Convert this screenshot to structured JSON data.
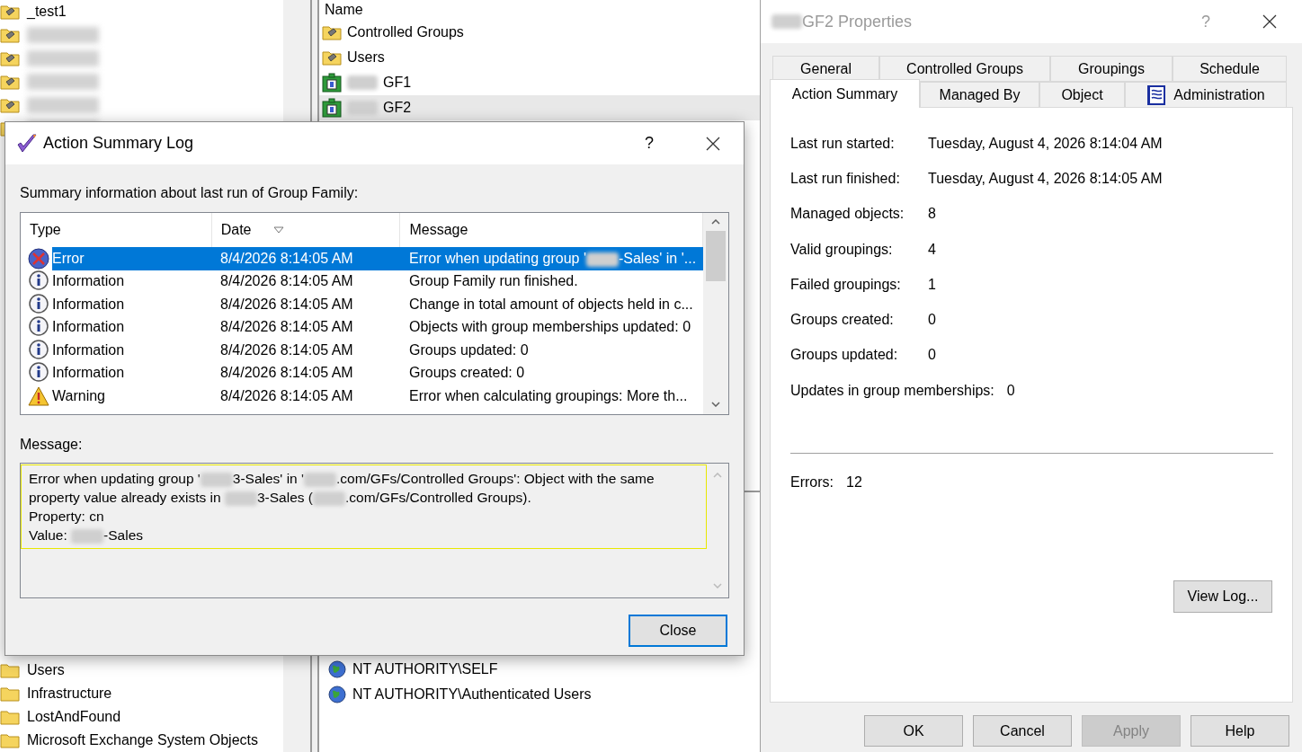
{
  "explorer": {
    "tree_top": [
      {
        "label": "_test1",
        "kind": "special"
      },
      {
        "kind": "special",
        "redacted": true
      },
      {
        "kind": "special",
        "redacted": true
      },
      {
        "kind": "special",
        "redacted": true
      },
      {
        "kind": "special",
        "redacted": true
      },
      {
        "kind": "plain",
        "redacted": true
      }
    ],
    "tree_bottom": [
      {
        "label": "Users",
        "kind": "plain"
      },
      {
        "label": "Infrastructure",
        "kind": "plain"
      },
      {
        "label": "LostAndFound",
        "kind": "plain"
      },
      {
        "label": "Microsoft Exchange System Objects",
        "kind": "plain"
      }
    ],
    "list_header": "Name",
    "list_items": [
      {
        "label": "Controlled Groups",
        "kind": "container",
        "selected": false,
        "redacted_prefix": false
      },
      {
        "label": "Users",
        "kind": "container",
        "selected": false,
        "redacted_prefix": false
      },
      {
        "label": "GF1",
        "kind": "family",
        "selected": false,
        "redacted_prefix": true
      },
      {
        "label": "GF2",
        "kind": "family",
        "selected": true,
        "redacted_prefix": true
      }
    ],
    "members": [
      {
        "label": "NT AUTHORITY\\SELF"
      },
      {
        "label": "NT AUTHORITY\\Authenticated Users"
      }
    ]
  },
  "properties": {
    "title": "GF2 Properties",
    "title_redacted_prefix": true,
    "help_glyph": "?",
    "tabs_back": [
      {
        "label": "General",
        "selected": false,
        "has_icon": false
      },
      {
        "label": "Controlled Groups",
        "selected": false,
        "has_icon": false
      },
      {
        "label": "Groupings",
        "selected": false,
        "has_icon": false
      },
      {
        "label": "Schedule",
        "selected": false,
        "has_icon": false
      }
    ],
    "tabs_front": [
      {
        "label": "Action Summary",
        "selected": true,
        "has_icon": false
      },
      {
        "label": "Managed By",
        "selected": false,
        "has_icon": false
      },
      {
        "label": "Object",
        "selected": false,
        "has_icon": false
      },
      {
        "label": "Administration",
        "selected": false,
        "has_icon": true
      }
    ],
    "fields": [
      {
        "label": "Last run started:",
        "value": "Tuesday, August 4, 2026 8:14:04 AM"
      },
      {
        "label": "Last run finished:",
        "value": "Tuesday, August 4, 2026 8:14:05 AM"
      },
      {
        "label": "Managed objects:",
        "value": "8"
      },
      {
        "label": "Valid groupings:",
        "value": "4"
      },
      {
        "label": "Failed groupings:",
        "value": "1"
      },
      {
        "label": "Groups created:",
        "value": "0"
      },
      {
        "label": "Groups updated:",
        "value": "0"
      },
      {
        "label": "Updates in group memberships:",
        "value": "0"
      }
    ],
    "errors": {
      "label": "Errors:",
      "value": "12"
    },
    "view_log": "View Log...",
    "buttons": [
      {
        "label": "OK",
        "disabled": false
      },
      {
        "label": "Cancel",
        "disabled": false
      },
      {
        "label": "Apply",
        "disabled": true
      },
      {
        "label": "Help",
        "disabled": false
      }
    ]
  },
  "log_dialog": {
    "title": "Action Summary Log",
    "help_glyph": "?",
    "summary_label": "Summary information about last run of Group Family:",
    "columns": [
      {
        "label": "Type",
        "sorted": false
      },
      {
        "label": "Date",
        "sorted": true
      },
      {
        "label": "Message",
        "sorted": false
      }
    ],
    "rows": [
      {
        "kind": "error",
        "type": "Error",
        "date": "8/4/2026 8:14:05 AM",
        "message": [
          "Error when updating group '",
          "-Sales' in '..."
        ],
        "selected": true
      },
      {
        "kind": "info",
        "type": "Information",
        "date": "8/4/2026 8:14:05 AM",
        "message": [
          "Group Family run finished."
        ],
        "selected": false
      },
      {
        "kind": "info",
        "type": "Information",
        "date": "8/4/2026 8:14:05 AM",
        "message": [
          "Change in total amount of objects held in c..."
        ],
        "selected": false
      },
      {
        "kind": "info",
        "type": "Information",
        "date": "8/4/2026 8:14:05 AM",
        "message": [
          "Objects with group memberships updated: 0"
        ],
        "selected": false
      },
      {
        "kind": "info",
        "type": "Information",
        "date": "8/4/2026 8:14:05 AM",
        "message": [
          "Groups updated: 0"
        ],
        "selected": false
      },
      {
        "kind": "info",
        "type": "Information",
        "date": "8/4/2026 8:14:05 AM",
        "message": [
          "Groups created: 0"
        ],
        "selected": false
      },
      {
        "kind": "warning",
        "type": "Warning",
        "date": "8/4/2026 8:14:05 AM",
        "message": [
          "Error when calculating groupings: More th..."
        ],
        "selected": false
      }
    ],
    "message_label": "Message:",
    "message_lines": [
      [
        "Error when updating group '",
        "3-Sales' in '",
        ".com/GFs/Controlled Groups': Object with the same"
      ],
      [
        "property value already exists in ",
        "3-Sales (",
        ".com/GFs/Controlled Groups)."
      ],
      [
        "Property: cn"
      ],
      [
        "Value: ",
        "-Sales"
      ]
    ],
    "close_button": "Close"
  }
}
